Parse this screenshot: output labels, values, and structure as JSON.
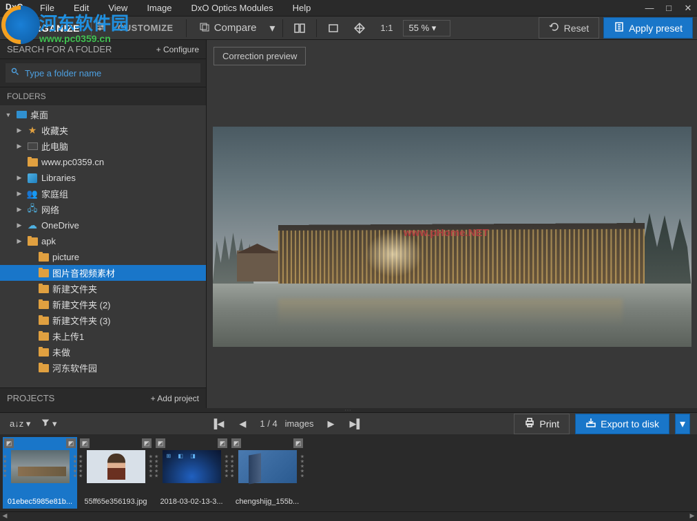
{
  "menubar": {
    "logo": "DxO",
    "items": [
      "File",
      "Edit",
      "View",
      "Image",
      "DxO Optics Modules",
      "Help"
    ]
  },
  "toolbar": {
    "organize_label": "ORGANIZE",
    "customize_label": "CUSTOMIZE",
    "compare_label": "Compare",
    "zoom_ratio": "1:1",
    "zoom_pct": "55 %",
    "reset_label": "Reset",
    "apply_label": "Apply preset"
  },
  "sidebar": {
    "search_header": "SEARCH FOR A FOLDER",
    "configure_label": "+ Configure",
    "search_placeholder": "Type a folder name",
    "folders_header": "FOLDERS",
    "tree": [
      {
        "indent": 0,
        "arrow": "▼",
        "icon": "desktop",
        "label": "桌面"
      },
      {
        "indent": 1,
        "arrow": "▶",
        "icon": "star",
        "label": "收藏夹"
      },
      {
        "indent": 1,
        "arrow": "▶",
        "icon": "pc",
        "label": "此电脑"
      },
      {
        "indent": 1,
        "arrow": "",
        "icon": "folder",
        "label": "www.pc0359.cn"
      },
      {
        "indent": 1,
        "arrow": "▶",
        "icon": "lib",
        "label": "Libraries"
      },
      {
        "indent": 1,
        "arrow": "▶",
        "icon": "group",
        "label": "家庭组"
      },
      {
        "indent": 1,
        "arrow": "▶",
        "icon": "net",
        "label": "网络"
      },
      {
        "indent": 1,
        "arrow": "▶",
        "icon": "onedrive",
        "label": "OneDrive"
      },
      {
        "indent": 1,
        "arrow": "▶",
        "icon": "folder",
        "label": "apk"
      },
      {
        "indent": 2,
        "arrow": "",
        "icon": "folder",
        "label": "picture"
      },
      {
        "indent": 2,
        "arrow": "",
        "icon": "folder",
        "label": "图片音视频素材",
        "selected": true
      },
      {
        "indent": 2,
        "arrow": "",
        "icon": "folder",
        "label": "新建文件夹"
      },
      {
        "indent": 2,
        "arrow": "",
        "icon": "folder",
        "label": "新建文件夹 (2)"
      },
      {
        "indent": 2,
        "arrow": "",
        "icon": "folder",
        "label": "新建文件夹 (3)"
      },
      {
        "indent": 2,
        "arrow": "",
        "icon": "folder",
        "label": "未上传1"
      },
      {
        "indent": 2,
        "arrow": "",
        "icon": "folder",
        "label": "未做"
      },
      {
        "indent": 2,
        "arrow": "",
        "icon": "folder",
        "label": "河东软件园"
      }
    ],
    "projects_header": "PROJECTS",
    "add_project_label": "+ Add project"
  },
  "preview": {
    "correction_btn": "Correction preview",
    "watermark": "www.pHome.NET"
  },
  "filmstrip": {
    "sort_az": "a↓z",
    "filter": "▼",
    "counter_current": "1",
    "counter_sep": "/",
    "counter_total": "4",
    "counter_suffix": "images",
    "print_label": "Print",
    "export_label": "Export to disk",
    "thumbs": [
      {
        "label": "01ebec5985e81b...",
        "selected": true
      },
      {
        "label": "55ff65e356193.jpg"
      },
      {
        "label": "2018-03-02-13-3..."
      },
      {
        "label": "chengshijg_155b..."
      }
    ]
  },
  "watermark": {
    "cn_text": "河东软件园",
    "url": "www.pc0359.cn"
  }
}
